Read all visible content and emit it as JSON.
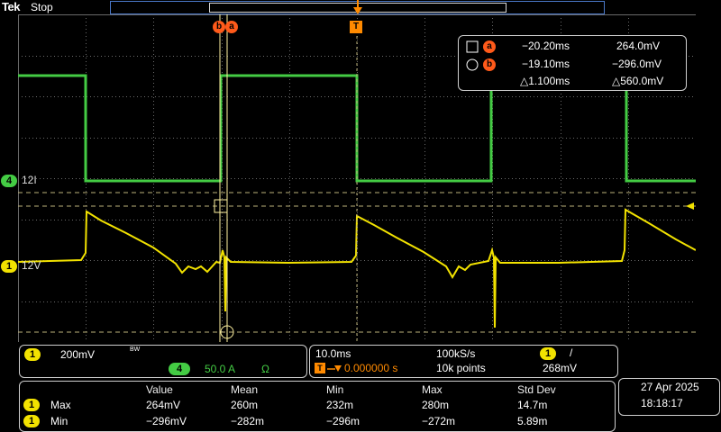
{
  "header": {
    "logo": "Tek",
    "run_state": "Stop"
  },
  "cursors": {
    "marker_b": "b",
    "marker_a": "a",
    "trigger_marker": "T",
    "readout": {
      "a_label": "a",
      "a_time": "−20.20ms",
      "a_value": "264.0mV",
      "b_label": "b",
      "b_time": "−19.10ms",
      "b_value": "−296.0mV",
      "delta_time": "△1.100ms",
      "delta_value": "△560.0mV"
    }
  },
  "channels": {
    "ch4": {
      "number": "4",
      "label": "12I",
      "color": "#44cc44"
    },
    "ch1": {
      "number": "1",
      "label": "12V",
      "color": "#f2e200"
    }
  },
  "ch1_panel": {
    "channel": "1",
    "scale": "200mV",
    "bw_flag": "BW",
    "ch4_number": "4",
    "ch4_scale": "50.0 A",
    "ch4_unit": "Ω"
  },
  "acquisition": {
    "timebase": "10.0ms",
    "sample_rate": "100kS/s",
    "trigger_channel": "1",
    "trigger_slope": "/",
    "trigger_prefix": "T",
    "trigger_delay": "0.000000 s",
    "record_length": "10k points",
    "trigger_level": "268mV"
  },
  "measurements": {
    "columns": [
      "Value",
      "Mean",
      "Min",
      "Max",
      "Std Dev"
    ],
    "rows": [
      {
        "channel": "1",
        "name": "Max",
        "cells": [
          "264mV",
          "260m",
          "232m",
          "280m",
          "14.7m"
        ]
      },
      {
        "channel": "1",
        "name": "Min",
        "cells": [
          "−296mV",
          "−282m",
          "−296m",
          "−272m",
          "5.89m"
        ]
      }
    ]
  },
  "datetime": {
    "date": "27 Apr  2025",
    "time": "18:18:17"
  },
  "colors": {
    "grid": "#6a6a6a",
    "ch4": "#44cc44",
    "ch1": "#f2e200",
    "cursor": "#fff2a0",
    "marker": "#ff5a1a",
    "record_bar": "#4a78c8"
  }
}
